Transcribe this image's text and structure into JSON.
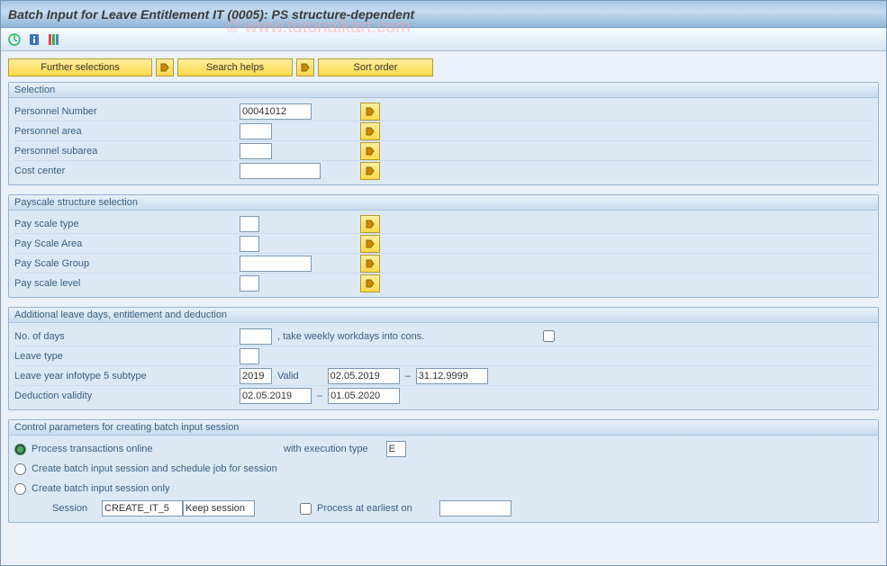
{
  "header": {
    "title": "Batch Input for Leave Entitlement IT (0005): PS structure-dependent",
    "watermark": "© www.tutorialkart.com"
  },
  "buttons": {
    "further": "Further selections",
    "search_helps": "Search helps",
    "sort_order": "Sort order"
  },
  "groups": {
    "selection": {
      "title": "Selection",
      "rows": [
        {
          "label": "Personnel Number",
          "value": "00041012"
        },
        {
          "label": "Personnel area",
          "value": ""
        },
        {
          "label": "Personnel subarea",
          "value": ""
        },
        {
          "label": "Cost center",
          "value": ""
        }
      ]
    },
    "payscale": {
      "title": "Payscale structure selection",
      "rows": [
        {
          "label": "Pay scale type"
        },
        {
          "label": "Pay Scale Area"
        },
        {
          "label": "Pay Scale Group"
        },
        {
          "label": "Pay scale level"
        }
      ]
    },
    "additional": {
      "title": "Additional leave days, entitlement and deduction",
      "no_of_days_label": "No. of days",
      "workdays_text": ", take weekly workdays into cons.",
      "leave_type_label": "Leave type",
      "leave_year_label": "Leave year infotype 5 subtype",
      "leave_year_value": "2019",
      "valid_text": "Valid",
      "valid_from": "02.05.2019",
      "valid_to": "31.12.9999",
      "deduction_label": "Deduction validity",
      "deduction_from": "02.05.2019",
      "deduction_to": "01.05.2020"
    },
    "control": {
      "title": "Control parameters for creating batch input session",
      "options": [
        "Process transactions online",
        "Create batch input session and schedule job for session",
        "Create batch input session only"
      ],
      "exec_type_label": "with execution type",
      "exec_type_value": "E",
      "session_label": "Session",
      "session_value": "CREATE_IT_5",
      "keep_session": "Keep session",
      "process_earliest_label": "Process at earliest on"
    }
  }
}
